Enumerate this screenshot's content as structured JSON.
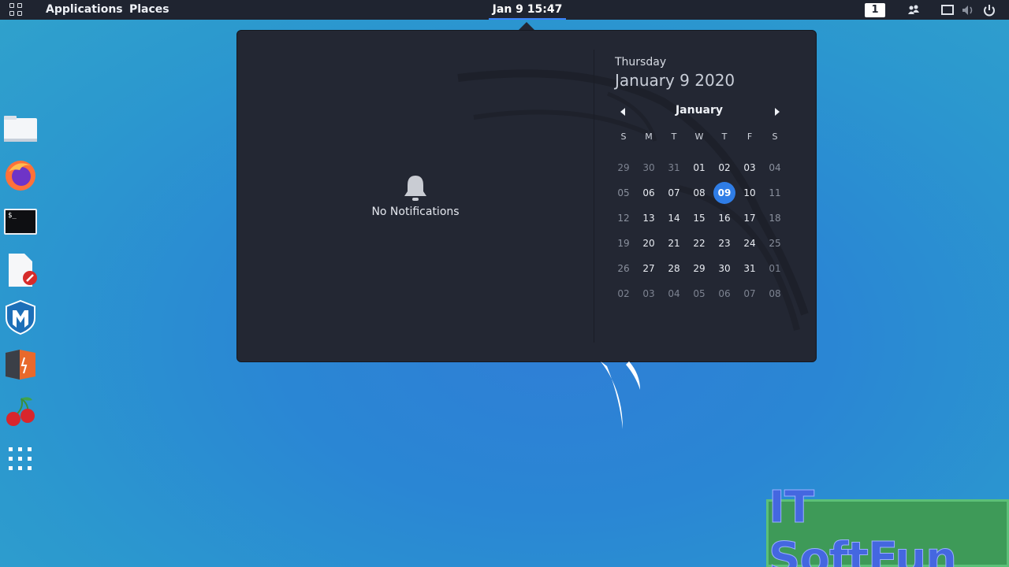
{
  "topbar": {
    "activities_icon": "app-grid-icon",
    "applications_label": "Applications",
    "places_label": "Places",
    "clock": "Jan 9  15:47",
    "workspace": "1",
    "tray_icons": [
      "people-icon",
      "screen-icon",
      "volume-icon",
      "power-icon"
    ]
  },
  "notifications": {
    "icon": "bell-icon",
    "empty_text": "No Notifications"
  },
  "calendar": {
    "day_name": "Thursday",
    "full_date": "January 9 2020",
    "month": "January",
    "weekdays": [
      "S",
      "M",
      "T",
      "W",
      "T",
      "F",
      "S"
    ],
    "days": [
      {
        "d": "29",
        "t": "other"
      },
      {
        "d": "30",
        "t": "other"
      },
      {
        "d": "31",
        "t": "other"
      },
      {
        "d": "01",
        "t": ""
      },
      {
        "d": "02",
        "t": ""
      },
      {
        "d": "03",
        "t": ""
      },
      {
        "d": "04",
        "t": "weekend"
      },
      {
        "d": "05",
        "t": "weekend"
      },
      {
        "d": "06",
        "t": ""
      },
      {
        "d": "07",
        "t": ""
      },
      {
        "d": "08",
        "t": ""
      },
      {
        "d": "09",
        "t": "today"
      },
      {
        "d": "10",
        "t": ""
      },
      {
        "d": "11",
        "t": "weekend"
      },
      {
        "d": "12",
        "t": "weekend"
      },
      {
        "d": "13",
        "t": ""
      },
      {
        "d": "14",
        "t": ""
      },
      {
        "d": "15",
        "t": ""
      },
      {
        "d": "16",
        "t": ""
      },
      {
        "d": "17",
        "t": ""
      },
      {
        "d": "18",
        "t": "weekend"
      },
      {
        "d": "19",
        "t": "weekend"
      },
      {
        "d": "20",
        "t": ""
      },
      {
        "d": "21",
        "t": ""
      },
      {
        "d": "22",
        "t": ""
      },
      {
        "d": "23",
        "t": ""
      },
      {
        "d": "24",
        "t": ""
      },
      {
        "d": "25",
        "t": "weekend"
      },
      {
        "d": "26",
        "t": "weekend"
      },
      {
        "d": "27",
        "t": ""
      },
      {
        "d": "28",
        "t": ""
      },
      {
        "d": "29",
        "t": ""
      },
      {
        "d": "30",
        "t": ""
      },
      {
        "d": "31",
        "t": ""
      },
      {
        "d": "01",
        "t": "other"
      },
      {
        "d": "02",
        "t": "other"
      },
      {
        "d": "03",
        "t": "other"
      },
      {
        "d": "04",
        "t": "other"
      },
      {
        "d": "05",
        "t": "other"
      },
      {
        "d": "06",
        "t": "other"
      },
      {
        "d": "07",
        "t": "other"
      },
      {
        "d": "08",
        "t": "other"
      }
    ],
    "accent_color": "#2f7de6"
  },
  "dock": [
    {
      "name": "file-manager-icon"
    },
    {
      "name": "firefox-icon"
    },
    {
      "name": "terminal-icon",
      "label": "$_"
    },
    {
      "name": "text-editor-icon"
    },
    {
      "name": "metasploit-icon"
    },
    {
      "name": "burpsuite-icon"
    },
    {
      "name": "cherrytree-icon"
    },
    {
      "name": "show-applications-icon"
    }
  ],
  "watermark": "IT SoftFun"
}
